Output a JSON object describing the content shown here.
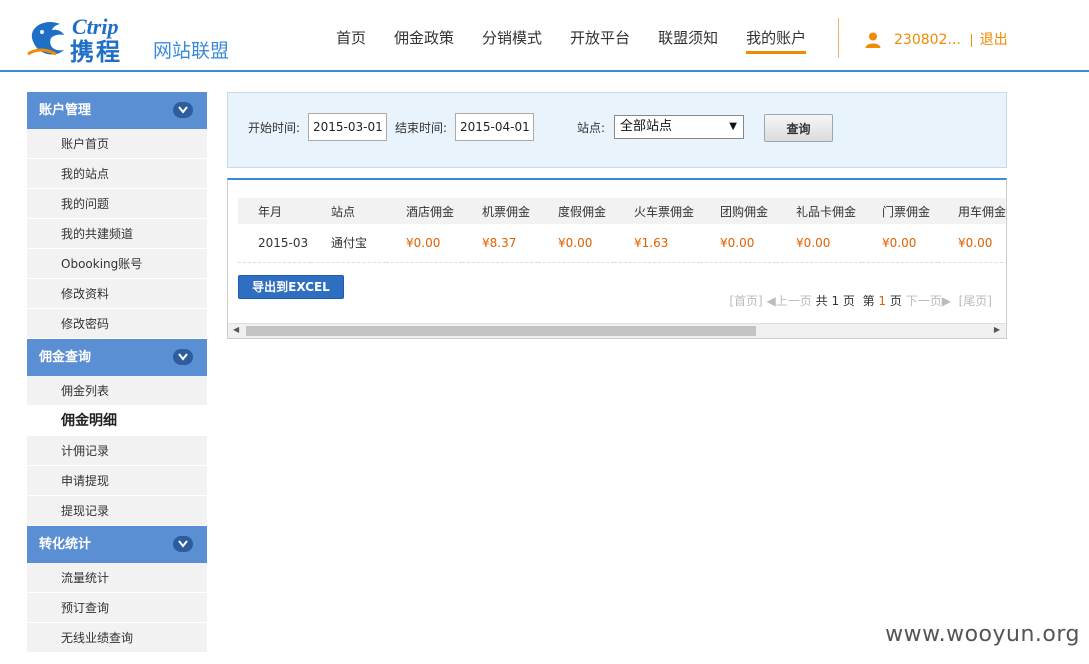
{
  "header": {
    "logo_en": "Ctrip",
    "logo_cn": "携程",
    "site_title": "网站联盟",
    "nav": [
      {
        "label": "首页"
      },
      {
        "label": "佣金政策"
      },
      {
        "label": "分销模式"
      },
      {
        "label": "开放平台"
      },
      {
        "label": "联盟须知"
      },
      {
        "label": "我的账户",
        "active": true
      }
    ],
    "user_id": "230802...",
    "logout_label": "退出"
  },
  "sidebar": {
    "sections": [
      {
        "title": "账户管理",
        "items": [
          "账户首页",
          "我的站点",
          "我的问题",
          "我的共建频道",
          "Obooking账号",
          "修改资料",
          "修改密码"
        ]
      },
      {
        "title": "佣金查询",
        "items": [
          "佣金列表",
          "佣金明细",
          "计佣记录",
          "申请提现",
          "提现记录"
        ]
      },
      {
        "title": "转化统计",
        "items": [
          "流量统计",
          "预订查询",
          "无线业绩查询"
        ]
      }
    ],
    "current_item": "佣金明细"
  },
  "filter": {
    "start_label": "开始时间:",
    "start_value": "2015-03-01",
    "end_label": "结束时间:",
    "end_value": "2015-04-01",
    "site_label": "站点:",
    "site_value": "全部站点",
    "query_label": "查询"
  },
  "table": {
    "headers": [
      "年月",
      "站点",
      "酒店佣金",
      "机票佣金",
      "度假佣金",
      "火车票佣金",
      "团购佣金",
      "礼品卡佣金",
      "门票佣金",
      "用车佣金"
    ],
    "rows": [
      [
        "2015-03",
        "通付宝",
        "¥0.00",
        "¥8.37",
        "¥0.00",
        "¥1.63",
        "¥0.00",
        "¥0.00",
        "¥0.00",
        "¥0.00"
      ]
    ]
  },
  "export_label": "导出到EXCEL",
  "pager": {
    "first": "[首页]",
    "prev": "上一页",
    "total_prefix": "共",
    "total_pages": "1",
    "page_unit": "页",
    "current_prefix": "第",
    "current_page": "1",
    "next": "下一页",
    "last": "[尾页]"
  },
  "watermark": "www.wooyun.org",
  "colors": {
    "brand_blue": "#3b8ad9",
    "sidebar_head": "#5b8fd3",
    "accent_orange": "#f08a00",
    "money": "#e06000",
    "export_button": "#2f6fc1"
  }
}
